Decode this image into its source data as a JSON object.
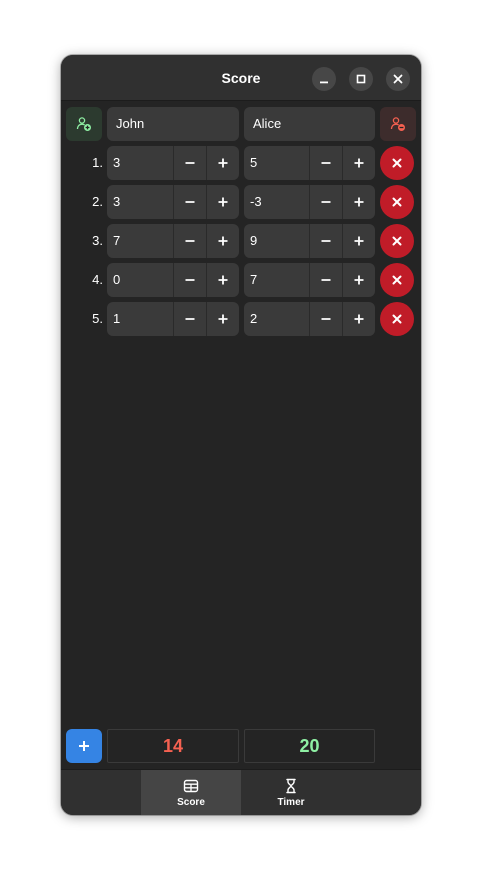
{
  "window": {
    "title": "Score"
  },
  "players": [
    {
      "name": "John"
    },
    {
      "name": "Alice"
    }
  ],
  "rounds": [
    {
      "number": "1.",
      "scores": [
        "3",
        "5"
      ]
    },
    {
      "number": "2.",
      "scores": [
        "3",
        "-3"
      ]
    },
    {
      "number": "3.",
      "scores": [
        "7",
        "9"
      ]
    },
    {
      "number": "4.",
      "scores": [
        "0",
        "7"
      ]
    },
    {
      "number": "5.",
      "scores": [
        "1",
        "2"
      ]
    }
  ],
  "totals": [
    {
      "value": "14",
      "color": "#f66151"
    },
    {
      "value": "20",
      "color": "#8ff0a4"
    }
  ],
  "icons": {
    "add_player": "add-player-icon",
    "remove_player": "remove-player-icon",
    "add_round": "plus-icon",
    "delete_round": "close-icon",
    "score_tab": "table-icon",
    "timer_tab": "hourglass-icon"
  },
  "colors": {
    "accent": "#3584e4",
    "destructive": "#c01c28",
    "add_player": "#8ff0a4",
    "remove_player": "#f66151"
  },
  "tabs": [
    {
      "label": "Score",
      "active": true
    },
    {
      "label": "Timer",
      "active": false
    }
  ]
}
